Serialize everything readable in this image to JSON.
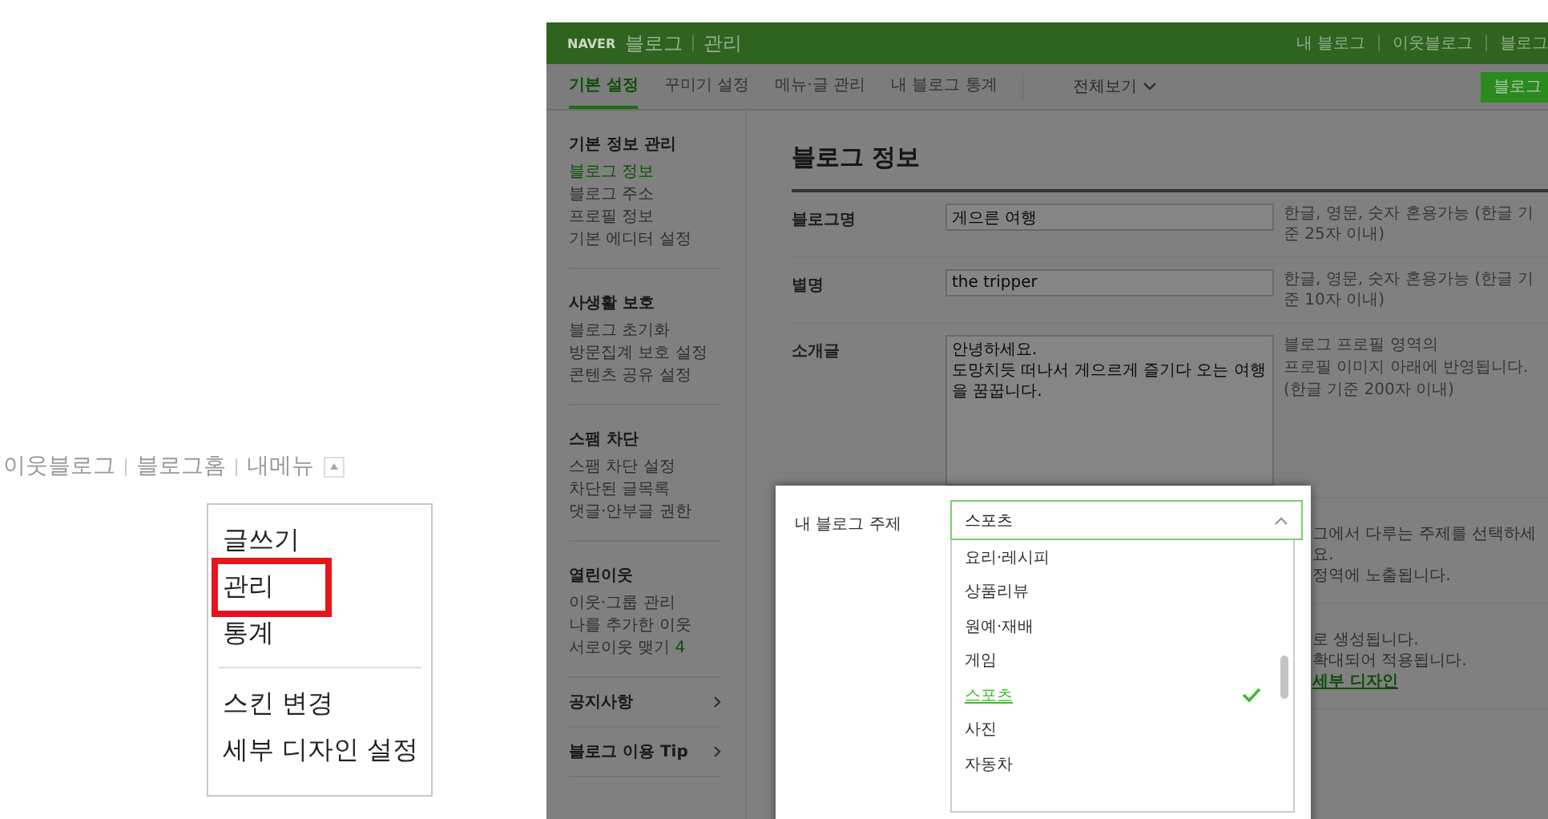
{
  "blog_menu": {
    "links": [
      {
        "label": "이웃블로그"
      },
      {
        "label": "블로그홈"
      },
      {
        "label": "내메뉴"
      }
    ],
    "dropdown": {
      "groups": [
        [
          {
            "label": "글쓰기",
            "highlighted": false
          },
          {
            "label": "관리",
            "highlighted": true
          },
          {
            "label": "통계",
            "highlighted": false
          }
        ],
        [
          {
            "label": "스킨 변경",
            "highlighted": false
          },
          {
            "label": "세부 디자인 설정",
            "highlighted": false
          }
        ]
      ]
    }
  },
  "admin": {
    "header": {
      "brand": "NAVER",
      "title": "블로그",
      "section": "관리",
      "links": [
        {
          "label": "내 블로그"
        },
        {
          "label": "이웃블로그"
        },
        {
          "label": "블로그"
        }
      ]
    },
    "tabs": [
      {
        "label": "기본 설정",
        "selected": true
      },
      {
        "label": "꾸미기 설정",
        "selected": false
      },
      {
        "label": "메뉴·글 관리",
        "selected": false
      },
      {
        "label": "내 블로그 통계",
        "selected": false
      }
    ],
    "view_all": "전체보기",
    "action_button": "블로그",
    "sidebar": [
      {
        "heading": "기본 정보 관리",
        "items": [
          {
            "label": "블로그 정보",
            "selected": true
          },
          {
            "label": "블로그 주소",
            "selected": false
          },
          {
            "label": "프로필 정보",
            "selected": false
          },
          {
            "label": "기본 에디터 설정",
            "selected": false
          }
        ]
      },
      {
        "heading": "사생활 보호",
        "items": [
          {
            "label": "블로그 초기화",
            "selected": false
          },
          {
            "label": "방문집계 보호 설정",
            "selected": false
          },
          {
            "label": "콘텐츠 공유 설정",
            "selected": false
          }
        ]
      },
      {
        "heading": "스팸 차단",
        "items": [
          {
            "label": "스팸 차단 설정",
            "selected": false
          },
          {
            "label": "차단된 글목록",
            "selected": false
          },
          {
            "label": "댓글·안부글 권한",
            "selected": false
          }
        ]
      },
      {
        "heading": "열린이웃",
        "items": [
          {
            "label": "이웃·그룹 관리",
            "selected": false
          },
          {
            "label": "나를 추가한 이웃",
            "selected": false
          },
          {
            "label": "서로이웃 맺기",
            "selected": false,
            "count": "4"
          }
        ]
      }
    ],
    "sidebar_links": [
      {
        "label": "공지사항"
      },
      {
        "label": "블로그 이용 Tip"
      }
    ],
    "page_title": "블로그 정보",
    "fields": [
      {
        "kind": "input",
        "label": "블로그명",
        "value": "게으른 여행",
        "hints": [
          "한글, 영문, 숫자 혼용가능 (한글 기준 25자 이내)"
        ]
      },
      {
        "kind": "input",
        "label": "별명",
        "value": "the tripper",
        "hints": [
          "한글, 영문, 숫자 혼용가능 (한글 기준 10자 이내)"
        ]
      },
      {
        "kind": "textarea",
        "label": "소개글",
        "value": "안녕하세요.\n도망치듯 떠나서 게으르게 즐기다 오는 여행을 꿈꿉니다.",
        "hints": [
          "블로그 프로필 영역의",
          "프로필 이미지 아래에 반영됩니다.",
          "(한글 기준 200자 이내)"
        ]
      }
    ],
    "covered_notes": [
      {
        "lines": [
          {
            "text": "그에서 다루는 주제를 선택하세요."
          },
          {
            "text": "정역에 노출됩니다."
          }
        ]
      },
      {
        "lines": [
          {
            "text": "로 생성됩니다."
          },
          {
            "text": "확대되어 적용됩니다.",
            "link": "세부 디자인"
          }
        ]
      }
    ],
    "topic_popup": {
      "label": "내 블로그 주제",
      "value": "스포츠",
      "options": [
        {
          "label": "요리·레시피",
          "selected": false
        },
        {
          "label": "상품리뷰",
          "selected": false
        },
        {
          "label": "원예·재배",
          "selected": false
        },
        {
          "label": "게임",
          "selected": false
        },
        {
          "label": "스포츠",
          "selected": true
        },
        {
          "label": "사진",
          "selected": false
        },
        {
          "label": "자동차",
          "selected": false
        }
      ]
    }
  }
}
